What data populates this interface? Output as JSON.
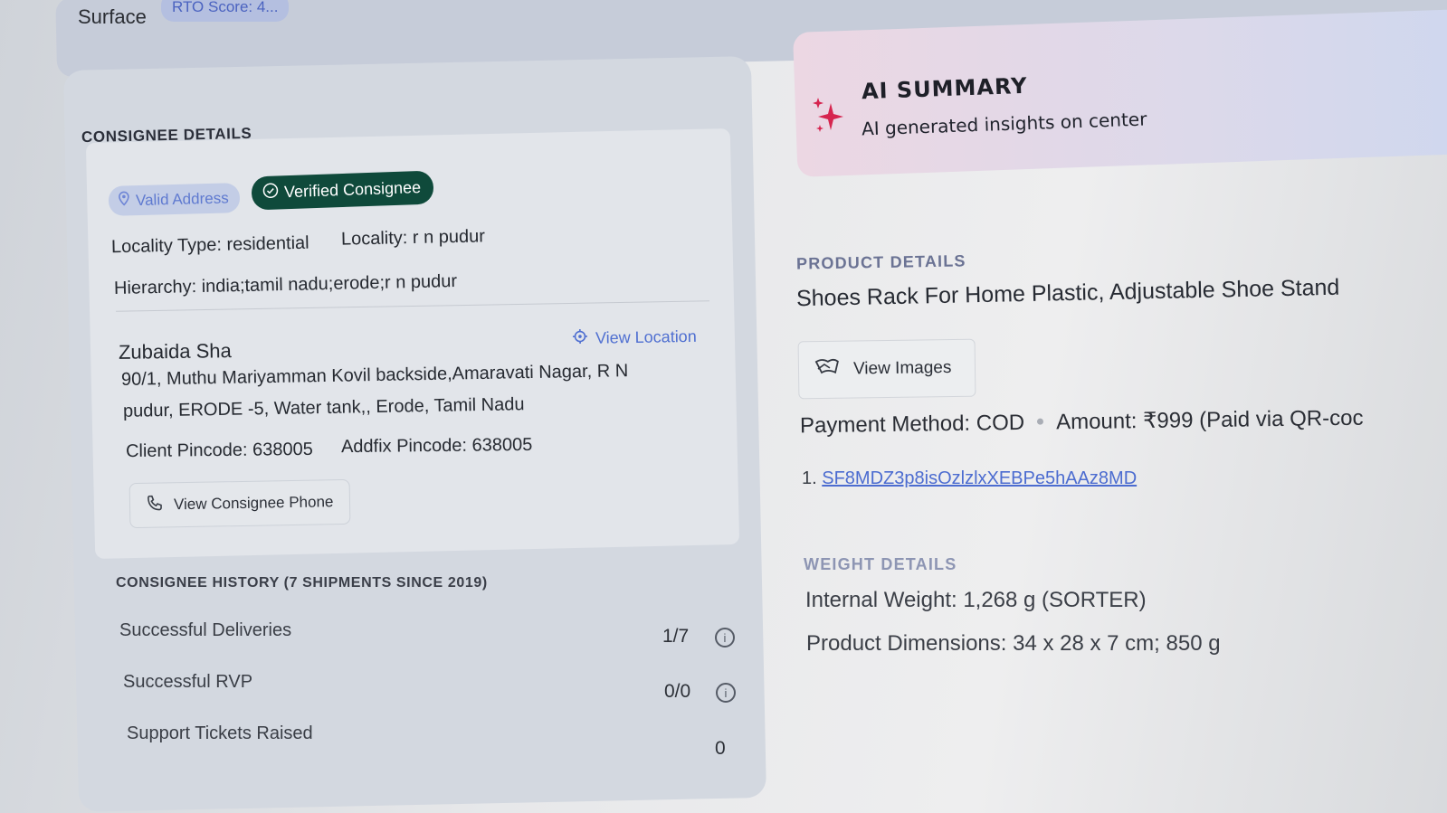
{
  "header": {
    "tab_surface": "Surface",
    "rto_score": "RTO Score: 4..."
  },
  "consignee": {
    "section_title": "CONSIGNEE DETAILS",
    "badge_valid": "Valid Address",
    "badge_verified": "Verified Consignee",
    "locality_type": "Locality Type: residential",
    "locality": "Locality: r n pudur",
    "hierarchy": "Hierarchy: india;tamil nadu;erode;r n pudur",
    "name": "Zubaida Sha",
    "view_location": "View Location",
    "address_line1": "90/1, Muthu Mariyamman Kovil backside,Amaravati Nagar, R N",
    "address_line2": "pudur, ERODE -5, Water tank,, Erode, Tamil Nadu",
    "client_pincode": "Client Pincode: 638005",
    "addfix_pincode": "Addfix Pincode: 638005",
    "view_phone": "View Consignee Phone"
  },
  "history": {
    "title": "CONSIGNEE HISTORY (7 SHIPMENTS SINCE 2019)",
    "rows": [
      {
        "label": "Successful Deliveries",
        "value": "1/7"
      },
      {
        "label": "Successful RVP",
        "value": "0/0"
      },
      {
        "label": "Support Tickets Raised",
        "value": "0"
      }
    ]
  },
  "ai_summary": {
    "title": "AI SUMMARY",
    "subtitle": "AI generated insights on center"
  },
  "product": {
    "section_title": "PRODUCT DETAILS",
    "name": "Shoes Rack For Home Plastic, Adjustable Shoe Stand",
    "view_images": "View Images",
    "payment_method": "Payment Method: COD",
    "amount": "Amount: ₹999 (Paid via QR-coc",
    "awb_index": "1.",
    "awb_link": "SF8MDZ3p8isOzlzlxXEBPe5hAAz8MD"
  },
  "weight": {
    "section_title": "WEIGHT DETAILS",
    "internal_weight": "Internal Weight: 1,268 g (SORTER)",
    "dimensions": "Product Dimensions: 34 x 28 x 7 cm; 850 g"
  },
  "colors": {
    "verified_badge": "#0f4a3b",
    "link": "#4f6fd1",
    "ai_accent": "#d6254f"
  }
}
